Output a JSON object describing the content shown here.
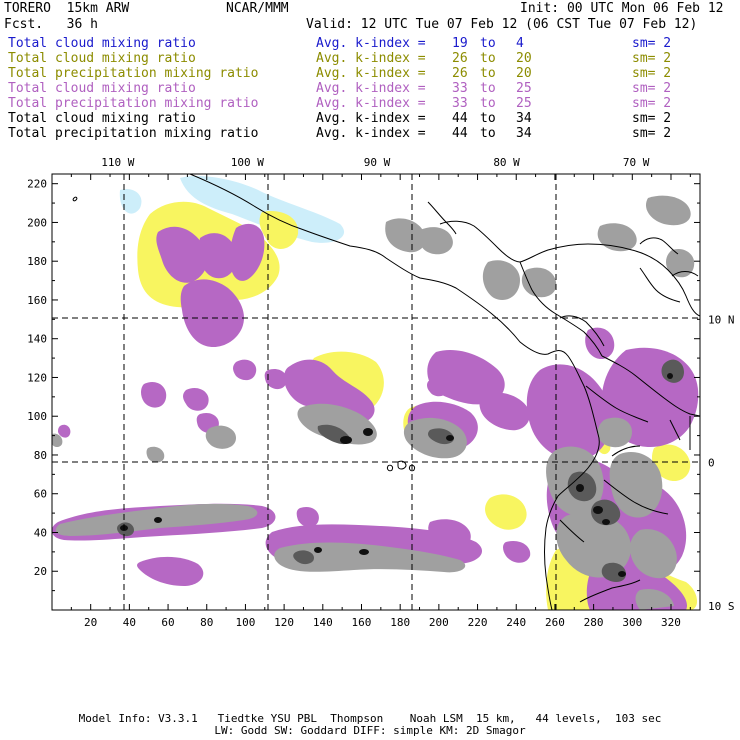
{
  "header": {
    "model": "TORERO  15km ARW",
    "org": "NCAR/MMM",
    "init": "Init: 00 UTC Mon 06 Feb 12",
    "fcst": "Fcst.   36 h",
    "valid": "Valid: 12 UTC Tue 07 Feb 12 (06 CST Tue 07 Feb 12)"
  },
  "legend": [
    {
      "name": "Total cloud mixing ratio",
      "label": "Avg. k-index =",
      "from": "19",
      "to_word": "to",
      "to": "4",
      "sm": "sm= 2",
      "color": "#1a1acc"
    },
    {
      "name": "Total cloud mixing ratio",
      "label": "Avg. k-index =",
      "from": "26",
      "to_word": "to",
      "to": "20",
      "sm": "sm= 2",
      "color": "#8c8c00"
    },
    {
      "name": "Total precipitation mixing ratio",
      "label": "Avg. k-index =",
      "from": "26",
      "to_word": "to",
      "to": "20",
      "sm": "sm= 2",
      "color": "#8c8c00"
    },
    {
      "name": "Total cloud mixing ratio",
      "label": "Avg. k-index =",
      "from": "33",
      "to_word": "to",
      "to": "25",
      "sm": "sm= 2",
      "color": "#b060c0"
    },
    {
      "name": "Total precipitation mixing ratio",
      "label": "Avg. k-index =",
      "from": "33",
      "to_word": "to",
      "to": "25",
      "sm": "sm= 2",
      "color": "#b060c0"
    },
    {
      "name": "Total cloud mixing ratio",
      "label": "Avg. k-index =",
      "from": "44",
      "to_word": "to",
      "to": "34",
      "sm": "sm= 2",
      "color": "#000000"
    },
    {
      "name": "Total precipitation mixing ratio",
      "label": "Avg. k-index =",
      "from": "44",
      "to_word": "to",
      "to": "34",
      "sm": "sm= 2",
      "color": "#000000"
    }
  ],
  "map": {
    "x_ticks": [
      20,
      40,
      60,
      80,
      100,
      120,
      140,
      160,
      180,
      200,
      220,
      240,
      260,
      280,
      300,
      320
    ],
    "y_ticks": [
      20,
      40,
      60,
      80,
      100,
      120,
      140,
      160,
      180,
      200,
      220
    ],
    "x_range": [
      0,
      335
    ],
    "y_range": [
      0,
      225
    ],
    "lon_labels": [
      {
        "text": "110 W",
        "x": 34
      },
      {
        "text": "100 W",
        "x": 101
      },
      {
        "text": "90 W",
        "x": 168
      },
      {
        "text": "80 W",
        "x": 235
      },
      {
        "text": "70 W",
        "x": 302
      }
    ],
    "lat_labels": [
      {
        "text": "10 N",
        "y": 150
      },
      {
        "text": "0",
        "y": 76
      },
      {
        "text": "10 S",
        "y": 2
      }
    ],
    "colors": {
      "light_blue": "#cdeefa",
      "yellow": "#f8f560",
      "purple": "#b668c4",
      "gray": "#a0a0a0",
      "dark_gray": "#5a5a5a",
      "black": "#101010"
    }
  },
  "footer": {
    "line1": "Model Info: V3.3.1   Tiedtke YSU PBL  Thompson    Noah LSM  15 km,   44 levels,  103 sec",
    "line2": "LW: Godd SW: Goddard DIFF: simple KM: 2D Smagor"
  }
}
